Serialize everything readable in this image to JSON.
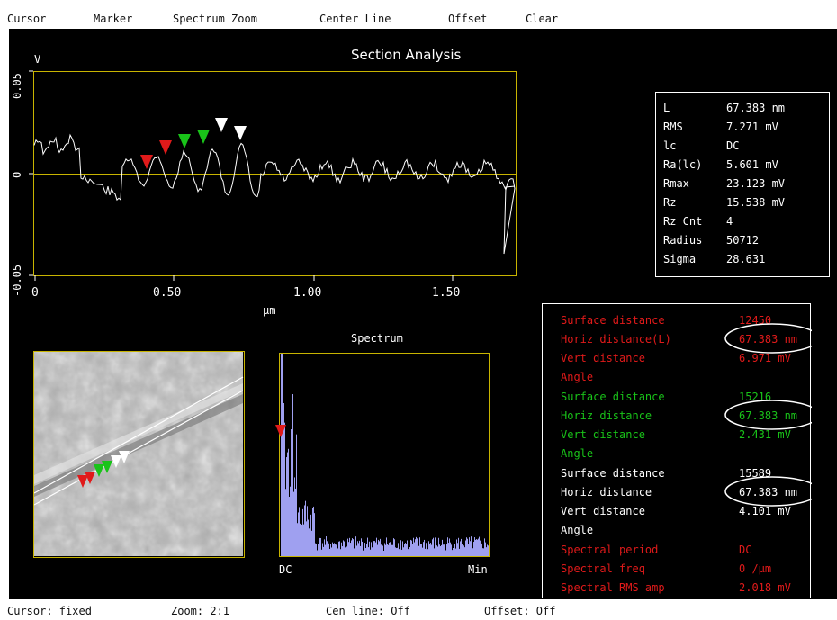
{
  "menu": [
    {
      "label": "Cursor",
      "name": "menu-cursor"
    },
    {
      "label": "Marker",
      "name": "menu-marker"
    },
    {
      "label": "Spectrum Zoom",
      "name": "menu-spectrum-zoom"
    },
    {
      "label": "Center Line",
      "name": "menu-center-line"
    },
    {
      "label": "Offset",
      "name": "menu-offset"
    },
    {
      "label": "Clear",
      "name": "menu-clear"
    }
  ],
  "section_plot": {
    "title": "Section Analysis",
    "y_unit": "V",
    "x_unit": "µm",
    "y_ticks": [
      "0.05",
      "0",
      "-0.05"
    ],
    "x_ticks": [
      "0",
      "0.50",
      "1.00",
      "1.50"
    ]
  },
  "stats": [
    {
      "label": "L",
      "value": "67.383 nm"
    },
    {
      "label": "RMS",
      "value": "7.271 mV"
    },
    {
      "label": "lc",
      "value": "DC"
    },
    {
      "label": "Ra(lc)",
      "value": "5.601 mV"
    },
    {
      "label": "Rmax",
      "value": "23.123 mV"
    },
    {
      "label": "Rz",
      "value": "15.538 mV"
    },
    {
      "label": "Rz Cnt",
      "value": "4"
    },
    {
      "label": "Radius",
      "value": "50712"
    },
    {
      "label": "Sigma",
      "value": "28.631"
    }
  ],
  "spectrum": {
    "title": "Spectrum",
    "x_left": "DC",
    "x_right": "Min"
  },
  "measurements": {
    "red": {
      "color": "#e01a1a",
      "surface_label": "Surface distance",
      "surface_value": "12450",
      "horiz_label": "Horiz distance(L)",
      "horiz_value": "67.383 nm",
      "vert_label": "Vert distance",
      "vert_value": "6.971 mV",
      "angle_label": "Angle"
    },
    "green": {
      "color": "#19c319",
      "surface_label": "Surface distance",
      "surface_value": "15216",
      "horiz_label": "Horiz distance",
      "horiz_value": "67.383 nm",
      "vert_label": "Vert distance",
      "vert_value": "2.431 mV",
      "angle_label": "Angle"
    },
    "white": {
      "color": "#ffffff",
      "surface_label": "Surface distance",
      "surface_value": "15589",
      "horiz_label": "Horiz distance",
      "horiz_value": "67.383 nm",
      "vert_label": "Vert distance",
      "vert_value": "4.101 mV",
      "angle_label": "Angle"
    },
    "spectral": {
      "color": "#e01a1a",
      "period_label": "Spectral period",
      "period_value": "DC",
      "freq_label": "Spectral freq",
      "freq_value": "0 /µm",
      "rms_label": "Spectral RMS amp",
      "rms_value": "2.018 mV"
    }
  },
  "status": {
    "cursor": "Cursor: fixed",
    "zoom": "Zoom: 2:1",
    "cen_line": "Cen line: Off",
    "offset": "Offset: Off"
  },
  "colors": {
    "axis": "#c8b400",
    "trace": "#ffffff",
    "spectrum_fill": "#9fa0f0",
    "marker_red": "#e01a1a",
    "marker_green": "#19c319",
    "marker_white": "#ffffff"
  }
}
